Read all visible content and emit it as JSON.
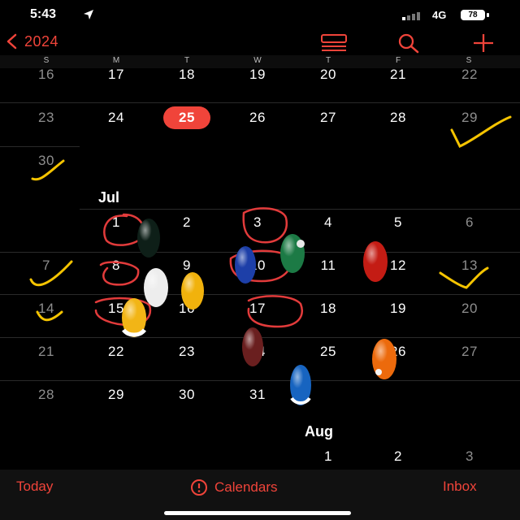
{
  "status": {
    "time": "5:43",
    "network": "4G",
    "battery": "78"
  },
  "nav": {
    "back_label": "2024",
    "icons": [
      "list-icon",
      "search-icon",
      "plus-icon"
    ]
  },
  "weekdays": [
    "S",
    "M",
    "T",
    "W",
    "T",
    "F",
    "S"
  ],
  "june": {
    "rows": [
      [
        "16",
        "17",
        "18",
        "19",
        "20",
        "21",
        "22"
      ],
      [
        "23",
        "24",
        "25",
        "26",
        "27",
        "28",
        "29"
      ],
      [
        "30"
      ]
    ],
    "today": "25"
  },
  "july": {
    "label": "Jul",
    "rows": [
      [
        "",
        "1",
        "2",
        "3",
        "4",
        "5",
        "6"
      ],
      [
        "7",
        "8",
        "9",
        "10",
        "11",
        "12",
        "13"
      ],
      [
        "14",
        "15",
        "16",
        "17",
        "18",
        "19",
        "20"
      ],
      [
        "21",
        "22",
        "23",
        "24",
        "25",
        "26",
        "27"
      ],
      [
        "28",
        "29",
        "30",
        "31",
        "",
        "",
        ""
      ]
    ]
  },
  "august": {
    "label": "Aug",
    "rows": [
      [
        "",
        "",
        "",
        "",
        "1",
        "2",
        "3"
      ]
    ]
  },
  "tabbar": {
    "today": "Today",
    "calendars": "Calendars",
    "inbox": "Inbox"
  },
  "colors": {
    "accent": "#f0443a",
    "background": "#000000",
    "weekend_text": "#8e8e8e",
    "annotation_red": "#e23b3b",
    "check_yellow": "#f5c400"
  }
}
